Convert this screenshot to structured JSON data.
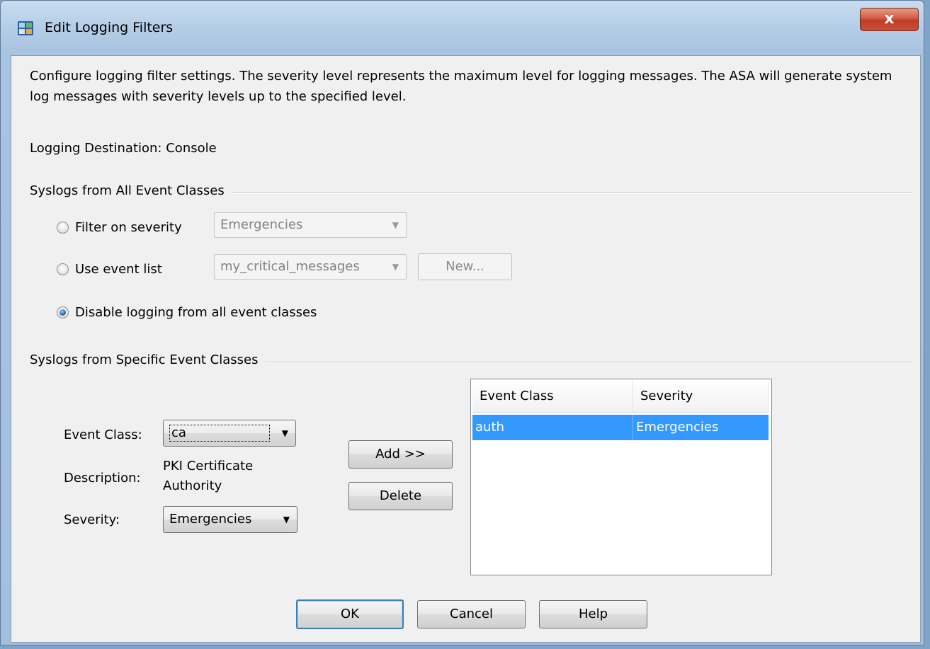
{
  "window": {
    "title": "Edit Logging Filters",
    "close_label": "x"
  },
  "intro_text": "Configure logging filter settings. The severity level represents the maximum level for logging messages. The ASA will generate system log messages with severity levels up to the specified level.",
  "destination": {
    "label": "Logging Destination:",
    "value": "Console"
  },
  "all_classes": {
    "group_title": "Syslogs from All Event Classes",
    "filter_severity": {
      "label": "Filter on severity",
      "checked": false,
      "combo_value": "Emergencies"
    },
    "use_event_list": {
      "label": "Use event list",
      "checked": false,
      "combo_value": "my_critical_messages",
      "new_button": "New..."
    },
    "disable_logging": {
      "label": "Disable logging from all event classes",
      "checked": true
    }
  },
  "specific_classes": {
    "group_title": "Syslogs from Specific Event Classes",
    "event_class_label": "Event Class:",
    "event_class_value": "ca",
    "description_label": "Description:",
    "description_line1": "PKI Certificate",
    "description_line2": "Authority",
    "severity_label": "Severity:",
    "severity_value": "Emergencies",
    "add_button": "Add >>",
    "delete_button": "Delete",
    "table": {
      "columns": [
        "Event Class",
        "Severity"
      ],
      "rows": [
        {
          "event_class": "auth",
          "severity": "Emergencies",
          "selected": true
        }
      ]
    }
  },
  "footer": {
    "ok": "OK",
    "cancel": "Cancel",
    "help": "Help"
  },
  "colors": {
    "selection": "#3399ff",
    "title_bar": "#b4cde6",
    "close_button": "#c13a23"
  }
}
